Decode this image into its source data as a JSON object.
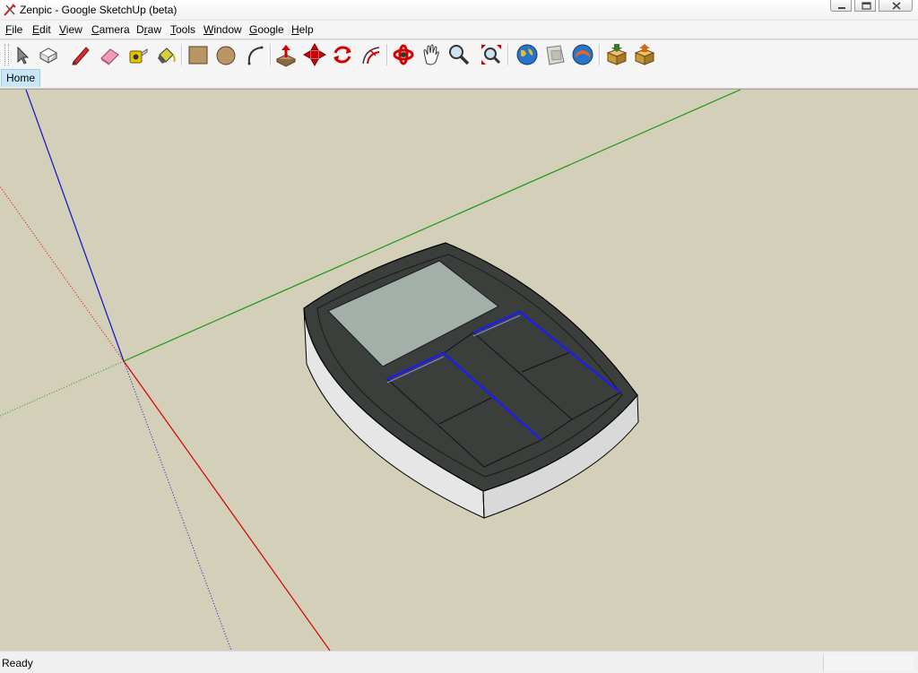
{
  "window": {
    "title": "Zenpic - Google SketchUp (beta)"
  },
  "menu": [
    {
      "label": "File",
      "mnemonic": "F"
    },
    {
      "label": "Edit",
      "mnemonic": "E"
    },
    {
      "label": "View",
      "mnemonic": "V"
    },
    {
      "label": "Camera",
      "mnemonic": "C"
    },
    {
      "label": "Draw",
      "mnemonic": "r"
    },
    {
      "label": "Tools",
      "mnemonic": "T"
    },
    {
      "label": "Window",
      "mnemonic": "W"
    },
    {
      "label": "Google",
      "mnemonic": "G"
    },
    {
      "label": "Help",
      "mnemonic": "H"
    }
  ],
  "toolbar": {
    "tools": [
      "select-icon",
      "make-component-icon",
      "pencil-icon",
      "eraser-icon",
      "tape-measure-icon",
      "paint-bucket-icon",
      "rectangle-icon",
      "circle-icon",
      "arc-icon",
      "push-pull-icon",
      "move-icon",
      "rotate-icon",
      "offset-icon",
      "orbit-icon",
      "pan-icon",
      "zoom-icon",
      "zoom-extents-icon",
      "earth-icon",
      "get-current-view-icon",
      "toggle-terrain-icon",
      "get-models-icon",
      "share-model-icon"
    ]
  },
  "scenes": {
    "tabs": [
      "Home"
    ]
  },
  "status": {
    "text": "Ready"
  },
  "colors": {
    "viewport_bg": "#d3cfb9",
    "axis_red": "#d40000",
    "axis_green": "#1a9a1a",
    "axis_blue": "#1010c8",
    "model_top": "#3a3f3b",
    "model_screen": "#a3b0aa",
    "model_side": "#e8e8e8",
    "selection_blue": "#1e1ee6",
    "scene_tab_bg": "#c7e6f7"
  }
}
